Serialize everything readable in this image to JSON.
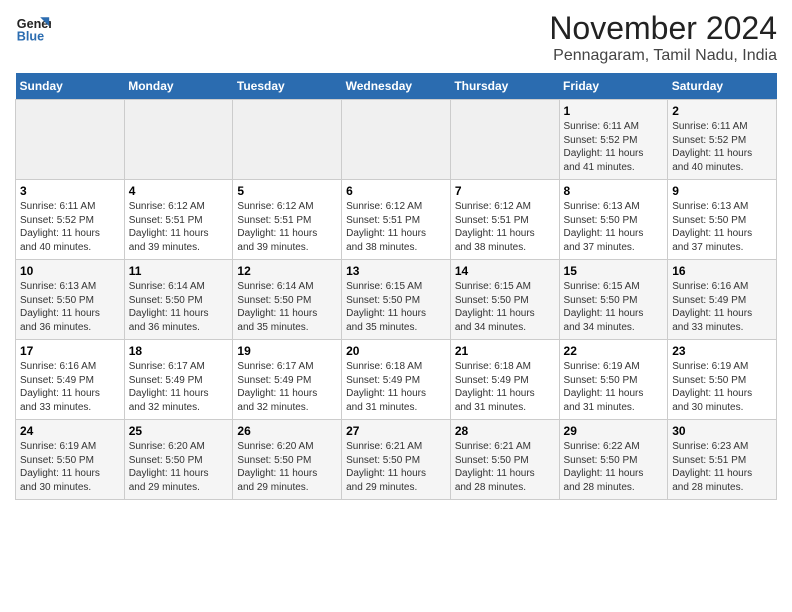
{
  "header": {
    "logo_line1": "General",
    "logo_line2": "Blue",
    "title": "November 2024",
    "subtitle": "Pennagaram, Tamil Nadu, India"
  },
  "weekdays": [
    "Sunday",
    "Monday",
    "Tuesday",
    "Wednesday",
    "Thursday",
    "Friday",
    "Saturday"
  ],
  "weeks": [
    [
      {
        "num": "",
        "info": "",
        "empty": true
      },
      {
        "num": "",
        "info": "",
        "empty": true
      },
      {
        "num": "",
        "info": "",
        "empty": true
      },
      {
        "num": "",
        "info": "",
        "empty": true
      },
      {
        "num": "",
        "info": "",
        "empty": true
      },
      {
        "num": "1",
        "info": "Sunrise: 6:11 AM\nSunset: 5:52 PM\nDaylight: 11 hours\nand 41 minutes.",
        "empty": false
      },
      {
        "num": "2",
        "info": "Sunrise: 6:11 AM\nSunset: 5:52 PM\nDaylight: 11 hours\nand 40 minutes.",
        "empty": false
      }
    ],
    [
      {
        "num": "3",
        "info": "Sunrise: 6:11 AM\nSunset: 5:52 PM\nDaylight: 11 hours\nand 40 minutes.",
        "empty": false
      },
      {
        "num": "4",
        "info": "Sunrise: 6:12 AM\nSunset: 5:51 PM\nDaylight: 11 hours\nand 39 minutes.",
        "empty": false
      },
      {
        "num": "5",
        "info": "Sunrise: 6:12 AM\nSunset: 5:51 PM\nDaylight: 11 hours\nand 39 minutes.",
        "empty": false
      },
      {
        "num": "6",
        "info": "Sunrise: 6:12 AM\nSunset: 5:51 PM\nDaylight: 11 hours\nand 38 minutes.",
        "empty": false
      },
      {
        "num": "7",
        "info": "Sunrise: 6:12 AM\nSunset: 5:51 PM\nDaylight: 11 hours\nand 38 minutes.",
        "empty": false
      },
      {
        "num": "8",
        "info": "Sunrise: 6:13 AM\nSunset: 5:50 PM\nDaylight: 11 hours\nand 37 minutes.",
        "empty": false
      },
      {
        "num": "9",
        "info": "Sunrise: 6:13 AM\nSunset: 5:50 PM\nDaylight: 11 hours\nand 37 minutes.",
        "empty": false
      }
    ],
    [
      {
        "num": "10",
        "info": "Sunrise: 6:13 AM\nSunset: 5:50 PM\nDaylight: 11 hours\nand 36 minutes.",
        "empty": false
      },
      {
        "num": "11",
        "info": "Sunrise: 6:14 AM\nSunset: 5:50 PM\nDaylight: 11 hours\nand 36 minutes.",
        "empty": false
      },
      {
        "num": "12",
        "info": "Sunrise: 6:14 AM\nSunset: 5:50 PM\nDaylight: 11 hours\nand 35 minutes.",
        "empty": false
      },
      {
        "num": "13",
        "info": "Sunrise: 6:15 AM\nSunset: 5:50 PM\nDaylight: 11 hours\nand 35 minutes.",
        "empty": false
      },
      {
        "num": "14",
        "info": "Sunrise: 6:15 AM\nSunset: 5:50 PM\nDaylight: 11 hours\nand 34 minutes.",
        "empty": false
      },
      {
        "num": "15",
        "info": "Sunrise: 6:15 AM\nSunset: 5:50 PM\nDaylight: 11 hours\nand 34 minutes.",
        "empty": false
      },
      {
        "num": "16",
        "info": "Sunrise: 6:16 AM\nSunset: 5:49 PM\nDaylight: 11 hours\nand 33 minutes.",
        "empty": false
      }
    ],
    [
      {
        "num": "17",
        "info": "Sunrise: 6:16 AM\nSunset: 5:49 PM\nDaylight: 11 hours\nand 33 minutes.",
        "empty": false
      },
      {
        "num": "18",
        "info": "Sunrise: 6:17 AM\nSunset: 5:49 PM\nDaylight: 11 hours\nand 32 minutes.",
        "empty": false
      },
      {
        "num": "19",
        "info": "Sunrise: 6:17 AM\nSunset: 5:49 PM\nDaylight: 11 hours\nand 32 minutes.",
        "empty": false
      },
      {
        "num": "20",
        "info": "Sunrise: 6:18 AM\nSunset: 5:49 PM\nDaylight: 11 hours\nand 31 minutes.",
        "empty": false
      },
      {
        "num": "21",
        "info": "Sunrise: 6:18 AM\nSunset: 5:49 PM\nDaylight: 11 hours\nand 31 minutes.",
        "empty": false
      },
      {
        "num": "22",
        "info": "Sunrise: 6:19 AM\nSunset: 5:50 PM\nDaylight: 11 hours\nand 31 minutes.",
        "empty": false
      },
      {
        "num": "23",
        "info": "Sunrise: 6:19 AM\nSunset: 5:50 PM\nDaylight: 11 hours\nand 30 minutes.",
        "empty": false
      }
    ],
    [
      {
        "num": "24",
        "info": "Sunrise: 6:19 AM\nSunset: 5:50 PM\nDaylight: 11 hours\nand 30 minutes.",
        "empty": false
      },
      {
        "num": "25",
        "info": "Sunrise: 6:20 AM\nSunset: 5:50 PM\nDaylight: 11 hours\nand 29 minutes.",
        "empty": false
      },
      {
        "num": "26",
        "info": "Sunrise: 6:20 AM\nSunset: 5:50 PM\nDaylight: 11 hours\nand 29 minutes.",
        "empty": false
      },
      {
        "num": "27",
        "info": "Sunrise: 6:21 AM\nSunset: 5:50 PM\nDaylight: 11 hours\nand 29 minutes.",
        "empty": false
      },
      {
        "num": "28",
        "info": "Sunrise: 6:21 AM\nSunset: 5:50 PM\nDaylight: 11 hours\nand 28 minutes.",
        "empty": false
      },
      {
        "num": "29",
        "info": "Sunrise: 6:22 AM\nSunset: 5:50 PM\nDaylight: 11 hours\nand 28 minutes.",
        "empty": false
      },
      {
        "num": "30",
        "info": "Sunrise: 6:23 AM\nSunset: 5:51 PM\nDaylight: 11 hours\nand 28 minutes.",
        "empty": false
      }
    ]
  ]
}
